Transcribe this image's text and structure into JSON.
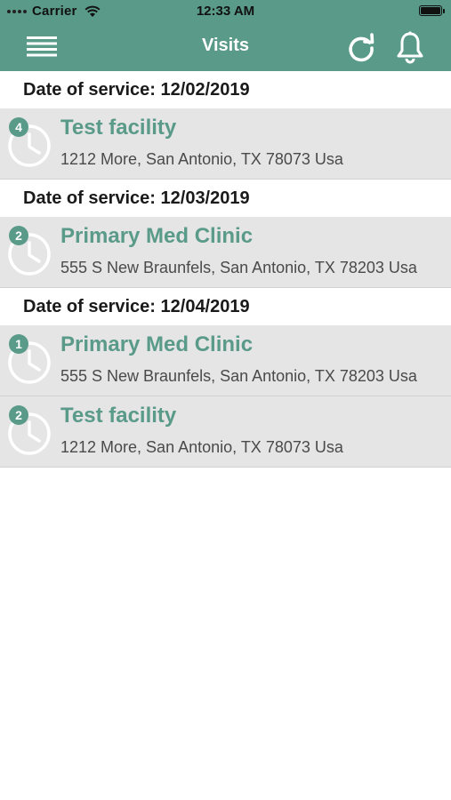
{
  "status_bar": {
    "carrier": "Carrier",
    "time": "12:33 AM"
  },
  "header": {
    "title": "Visits",
    "background": "#5a9a89",
    "icons": [
      "menu-icon",
      "refresh-icon",
      "bell-icon"
    ]
  },
  "groups": [
    {
      "date_label": "Date of service: 12/02/2019",
      "visits": [
        {
          "count": "4",
          "facility": "Test facility",
          "address": "1212 More, San Antonio, TX 78073 Usa"
        }
      ]
    },
    {
      "date_label": "Date of service: 12/03/2019",
      "visits": [
        {
          "count": "2",
          "facility": "Primary Med Clinic",
          "address": "555 S New Braunfels, San Antonio, TX 78203 Usa"
        }
      ]
    },
    {
      "date_label": "Date of service: 12/04/2019",
      "visits": [
        {
          "count": "1",
          "facility": "Primary Med Clinic",
          "address": "555 S New Braunfels, San Antonio, TX 78203 Usa"
        },
        {
          "count": "2",
          "facility": "Test facility",
          "address": "1212 More, San Antonio, TX 78073 Usa"
        }
      ]
    }
  ],
  "colors": {
    "accent": "#5a9a89",
    "row_background": "#e5e5e5"
  }
}
